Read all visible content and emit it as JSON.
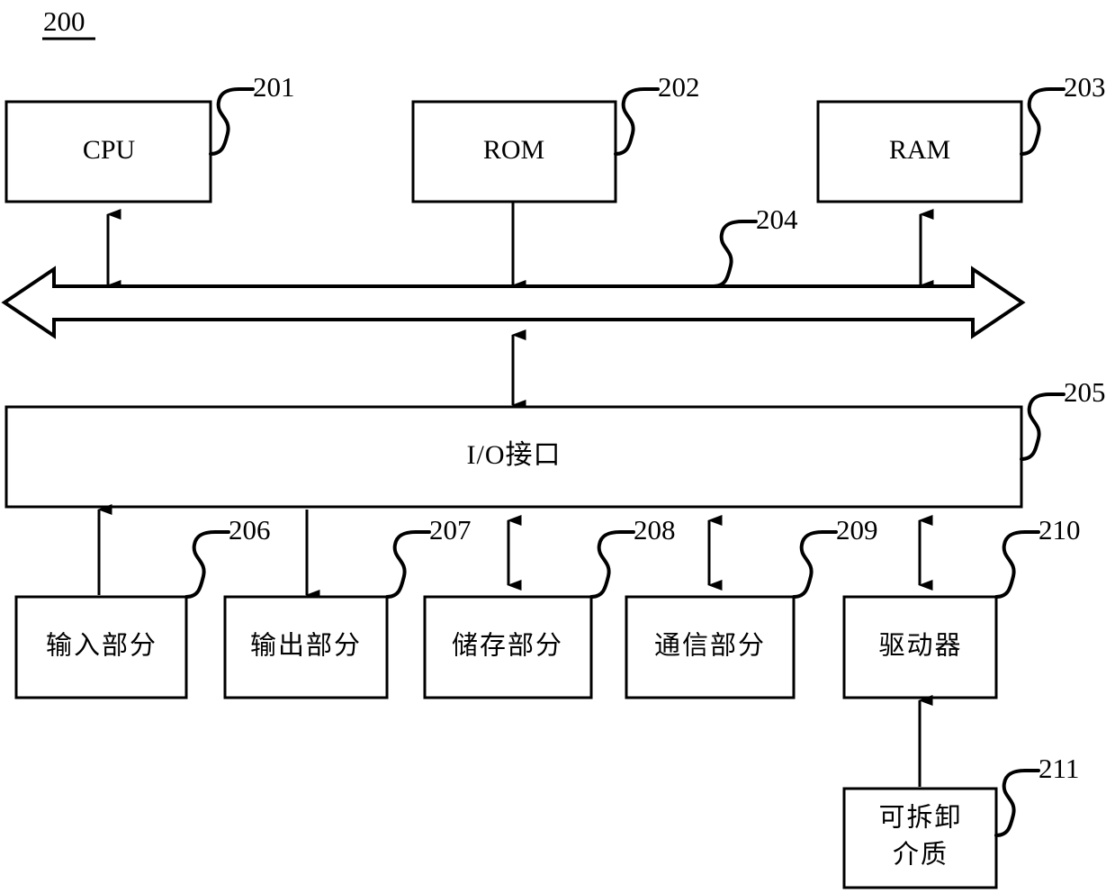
{
  "figure": {
    "number": "200",
    "underlined": true
  },
  "blocks": [
    {
      "id": "cpu",
      "label": "CPU",
      "ref": "201"
    },
    {
      "id": "rom",
      "label": "ROM",
      "ref": "202"
    },
    {
      "id": "ram",
      "label": "RAM",
      "ref": "203"
    },
    {
      "id": "bus",
      "label": "",
      "ref": "204"
    },
    {
      "id": "io",
      "label": "I/O接口",
      "ref": "205"
    },
    {
      "id": "input",
      "label": "输入部分",
      "ref": "206"
    },
    {
      "id": "output",
      "label": "输出部分",
      "ref": "207"
    },
    {
      "id": "storage",
      "label": "储存部分",
      "ref": "208"
    },
    {
      "id": "comm",
      "label": "通信部分",
      "ref": "209"
    },
    {
      "id": "driver",
      "label": "驱动器",
      "ref": "210"
    },
    {
      "id": "media",
      "label_line1": "可拆卸",
      "label_line2": "介质",
      "ref": "211"
    }
  ],
  "refs": {
    "cpu": "201",
    "rom": "202",
    "ram": "203",
    "bus": "204",
    "io": "205",
    "input": "206",
    "output": "207",
    "storage": "208",
    "comm": "209",
    "driver": "210",
    "media": "211"
  },
  "labels": {
    "cpu": "CPU",
    "rom": "ROM",
    "ram": "RAM",
    "io": "I/O接口",
    "input": "输入部分",
    "output": "输出部分",
    "storage": "储存部分",
    "comm": "通信部分",
    "driver": "驱动器",
    "media_line1": "可拆卸",
    "media_line2": "介质"
  },
  "colors": {
    "stroke": "#000000",
    "fill": "#ffffff",
    "background": "#ffffff"
  }
}
